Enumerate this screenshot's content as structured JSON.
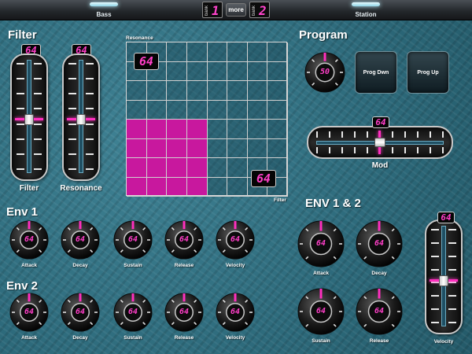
{
  "topbar": {
    "left_tab": "Bass",
    "right_tab": "Station",
    "bank1_label": "bank",
    "bank1_value": "1",
    "more_label": "more",
    "bank2_label": "bank",
    "bank2_value": "2"
  },
  "filter": {
    "heading": "Filter",
    "cutoff_value": "64",
    "cutoff_label": "Filter",
    "resonance_value": "64",
    "resonance_label": "Resonance"
  },
  "xy_pad": {
    "y_label": "Resonance",
    "x_label": "Filter",
    "top_value": "64",
    "bottom_value": "64",
    "selection_x": 0.5,
    "selection_y": 0.5
  },
  "program": {
    "heading": "Program",
    "knob_value": "50",
    "prev_label": "Prog Dwn",
    "next_label": "Prog Up",
    "mod_value": "64",
    "mod_label": "Mod"
  },
  "env1": {
    "heading": "Env 1",
    "knobs": [
      {
        "label": "Attack",
        "value": "64"
      },
      {
        "label": "Decay",
        "value": "64"
      },
      {
        "label": "Sustain",
        "value": "64"
      },
      {
        "label": "Release",
        "value": "64"
      },
      {
        "label": "Velocity",
        "value": "64"
      }
    ]
  },
  "env2": {
    "heading": "Env 2",
    "knobs": [
      {
        "label": "Attack",
        "value": "64"
      },
      {
        "label": "Decay",
        "value": "64"
      },
      {
        "label": "Sustain",
        "value": "64"
      },
      {
        "label": "Release",
        "value": "64"
      },
      {
        "label": "Velocity",
        "value": "64"
      }
    ]
  },
  "env12": {
    "heading": "ENV 1 & 2",
    "knobs": [
      {
        "label": "Attack",
        "value": "64"
      },
      {
        "label": "Decay",
        "value": "64"
      },
      {
        "label": "Sustain",
        "value": "64"
      },
      {
        "label": "Release",
        "value": "64"
      }
    ],
    "velocity_value": "64",
    "velocity_label": "Velocity"
  },
  "colors": {
    "accent": "#ff2fbf",
    "background": "#2f6f80",
    "pad_fill": "#c8189e"
  },
  "icons": {
    "knob": "rotary-knob-icon",
    "fader": "slider-fader-icon"
  }
}
